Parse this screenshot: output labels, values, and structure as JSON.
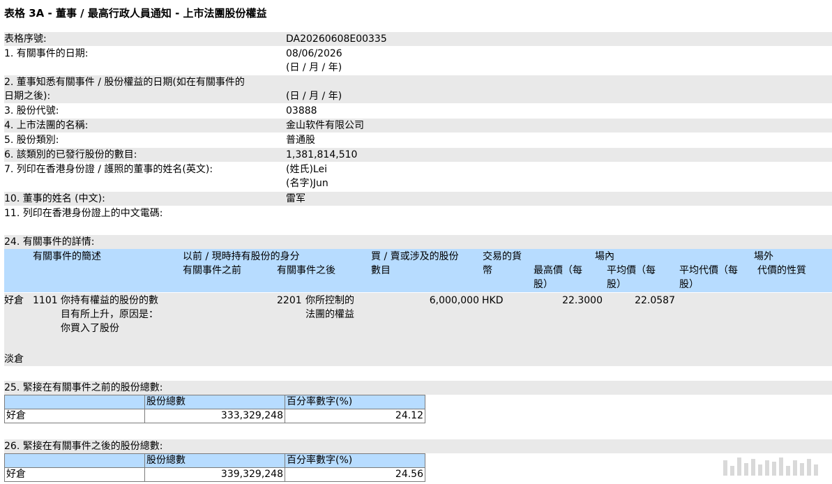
{
  "title": "表格 3A - 董事 / 最高行政人員通知 - 上市法團股份權益",
  "fields": {
    "form_serial": {
      "label": "表格序號:",
      "value": "DA20260608E00335"
    },
    "event_date": {
      "label": "1. 有關事件的日期:",
      "value": "08/06/2026",
      "note": "(日 / 月 / 年)"
    },
    "aware_date": {
      "label_line1": "2. 董事知悉有關事件 / 股份權益的日期(如在有關事件的",
      "label_line2": "日期之後):",
      "note": "(日 / 月 / 年)"
    },
    "stock_code": {
      "label": "3. 股份代號:",
      "value": "03888"
    },
    "corp_name": {
      "label": "4. 上市法團的名稱:",
      "value": "金山软件有限公司"
    },
    "share_class": {
      "label": "5. 股份類別:",
      "value": "普通股"
    },
    "issued_shares": {
      "label": "6. 該類別的已發行股份的數目:",
      "value": "1,381,814,510"
    },
    "director_name_en": {
      "label": "7. 列印在香港身份證 / 護照的董事的姓名(英文):",
      "surname": "(姓氏)Lei",
      "given": "(名字)Jun"
    },
    "director_name_cn": {
      "label": "10. 董事的姓名 (中文):",
      "value": "雷军"
    },
    "cn_code": {
      "label": "11. 列印在香港身份證上的中文電碼:"
    }
  },
  "section24": {
    "label": "24. 有關事件的詳情:",
    "headers": {
      "description": "有關事件的簡述",
      "capacity": "以前 / 現時持有股份的身分",
      "before": "有關事件之前",
      "after": "有關事件之後",
      "shares_line1": "買 / 賣或涉及的股份",
      "shares_line2": "數目",
      "currency_line1": "交易的貨",
      "currency_line2": "幣",
      "on_exchange": "場內",
      "highest_line1": "最高價（每",
      "highest_line2": "股）",
      "average_line1": "平均價（每",
      "average_line2": "股）",
      "off_exchange": "場外",
      "avg_consid_line1": "平均代價（每",
      "avg_consid_line2": "股）",
      "consid_nature": "代價的性質"
    },
    "long_row": {
      "position": "好倉",
      "code": "1101",
      "desc_line1": "你持有權益的股份的數",
      "desc_line2": "目有所上升，原因是：",
      "desc_line3": "你買入了股份",
      "after_code": "2201",
      "after_line1": "你所控制的",
      "after_line2": "法團的權益",
      "shares": "6,000,000",
      "currency": "HKD",
      "highest": "22.3000",
      "average": "22.0587"
    },
    "short_label": "淡倉"
  },
  "section25": {
    "label": "25. 緊接在有關事件之前的股份總數:",
    "col_shares": "股份總數",
    "col_pct": "百分率數字(%)",
    "rows": [
      {
        "position": "好倉",
        "shares": "333,329,248",
        "pct": "24.12"
      }
    ]
  },
  "section26": {
    "label": "26. 緊接在有關事件之後的股份總數:",
    "col_shares": "股份總數",
    "col_pct": "百分率數字(%)",
    "rows": [
      {
        "position": "好倉",
        "shares": "339,329,248",
        "pct": "24.56"
      }
    ]
  },
  "colors": {
    "gray_row": "#e9e9e9",
    "blue_header": "#b7dcff"
  }
}
